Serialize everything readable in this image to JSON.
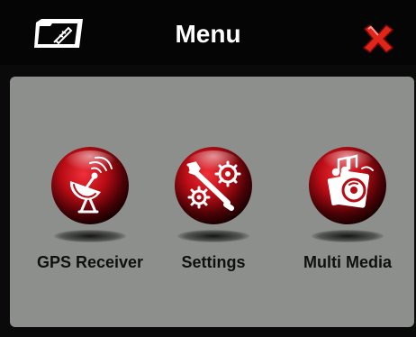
{
  "header": {
    "title": "Menu",
    "folder_icon": "folder-icon",
    "close_icon": "close-icon"
  },
  "menu": {
    "items": [
      {
        "label": "GPS Receiver",
        "icon": "satellite-dish-icon"
      },
      {
        "label": "Settings",
        "icon": "gears-wrench-icon"
      },
      {
        "label": "Multi Media",
        "icon": "media-disc-icon"
      }
    ]
  },
  "colors": {
    "header_bg": "#050505",
    "panel_bg": "#8c8f8b",
    "accent_red": "#c0141b",
    "close_red": "#e1251b"
  }
}
